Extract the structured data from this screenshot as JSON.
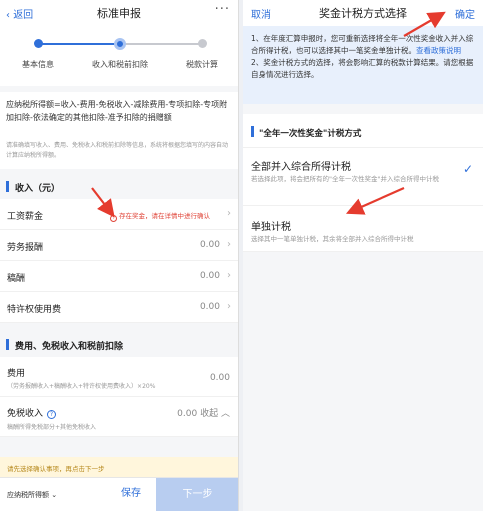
{
  "left": {
    "nav": {
      "back": "返回",
      "title": "标准申报",
      "more": "···"
    },
    "steps": [
      {
        "label": "基本信息",
        "state": "done"
      },
      {
        "label": "收入和税前扣除",
        "state": "current"
      },
      {
        "label": "税款计算",
        "state": "todo"
      }
    ],
    "formula": "应纳税所得额=收入-费用-免税收入-减除费用-专项扣除-专项附加扣除-依法确定的其他扣除-准予扣除的捐赠额",
    "formula_note": "请准确填写收入、费用、免税收入和税前扣除等信息，系统将根据您填写的内容自动计算应纳税所得额。",
    "income_section": "收入（元）",
    "income_rows": [
      {
        "label": "工资薪金",
        "value": "",
        "warning": "存在奖金，请在详情中进行确认"
      },
      {
        "label": "劳务报酬",
        "value": "0.00"
      },
      {
        "label": "稿酬",
        "value": "0.00"
      },
      {
        "label": "特许权使用费",
        "value": "0.00"
      }
    ],
    "deduction_section": "费用、免税收入和税前扣除",
    "expense": {
      "label": "费用",
      "sub": "（劳务报酬收入+稿酬收入+特许权使用费收入）×20%",
      "value": "0.00"
    },
    "exempt": {
      "label": "免税收入",
      "sub": "稿酬所得免税部分+其他免税收入",
      "value": "0.00",
      "toggle": "收起"
    },
    "tip": "请先选择确认事项，再点击下一步",
    "bottom": {
      "tax_label": "应纳税所得额",
      "save": "保存",
      "next": "下一步"
    }
  },
  "right": {
    "nav": {
      "cancel": "取消",
      "title": "奖金计税方式选择",
      "ok": "确定"
    },
    "notice_1": "1、在年度汇算申报时，您可重新选择将全年一次性奖金收入并入综合所得计税，也可以选择其中一笔奖金单独计税。",
    "notice_link": "查看政策说明",
    "notice_2": "2、奖金计税方式的选择，将会影响汇算的税款计算结果。请您根据自身情况进行选择。",
    "section": "\"全年一次性奖金\"计税方式",
    "options": [
      {
        "title": "全部并入综合所得计税",
        "desc": "若选择此项，将会把所有的\"全年一次性奖金\"并入综合所得中计税",
        "selected": true
      },
      {
        "title": "单独计税",
        "desc": "选择其中一笔单独计税，其余将全部并入综合所得中计税",
        "selected": false
      }
    ]
  },
  "colors": {
    "accent": "#2f6fd9",
    "annotation_arrow": "#e53b2e"
  }
}
